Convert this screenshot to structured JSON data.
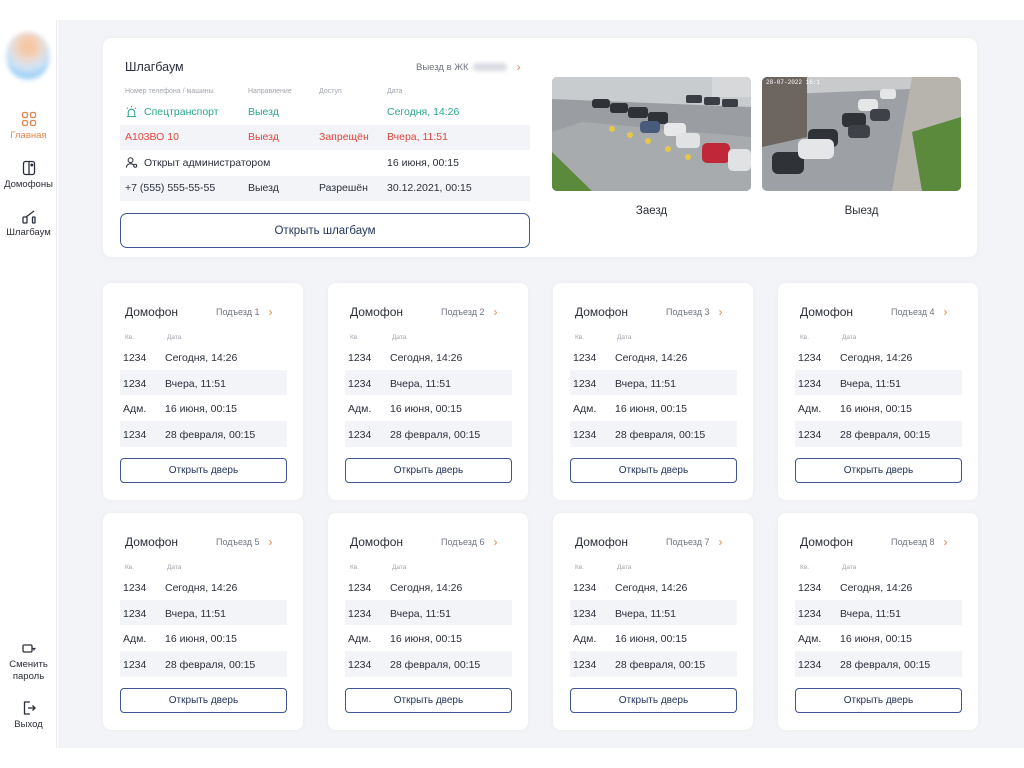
{
  "sidebar": {
    "items": [
      {
        "label": "Главная",
        "icon": "grid-icon",
        "active": true
      },
      {
        "label": "Домофоны",
        "icon": "intercom-icon"
      },
      {
        "label": "Шлагбаум",
        "icon": "barrier-icon"
      }
    ],
    "bottom": [
      {
        "label": "Сменить пароль",
        "icon": "key-icon"
      },
      {
        "label": "Выход",
        "icon": "logout-icon"
      }
    ]
  },
  "barrier": {
    "title": "Шлагбаум",
    "link_label": "Выезд в ЖК",
    "columns": [
      "Номер телефона / машины",
      "Направление",
      "Доступ",
      "Дата"
    ],
    "rows": [
      {
        "who": "Спецтранспорт",
        "dir": "Выезд",
        "access": "",
        "date": "Сегодня, 14:26",
        "style": "green",
        "icon": "siren-icon"
      },
      {
        "who": "А103ВО 10",
        "dir": "Выезд",
        "access": "Запрещён",
        "date": "Вчера, 11:51",
        "style": "red",
        "icon": ""
      },
      {
        "who": "Открыт администратором",
        "dir": "",
        "access": "",
        "date": "16 июня, 00:15",
        "style": "normal",
        "icon": "admin-icon"
      },
      {
        "who": "+7 (555) 555-55-55",
        "dir": "Выезд",
        "access": "Разрешён",
        "date": "30.12.2021, 00:15",
        "style": "normal",
        "icon": ""
      }
    ],
    "open_button": "Открыть шлагбаум",
    "cameras": [
      {
        "label": "Заезд",
        "timestamp": ""
      },
      {
        "label": "Выезд",
        "timestamp": "28-07-2022 16:1"
      }
    ]
  },
  "intercom": {
    "title": "Домофон",
    "col_apt": "Кв.",
    "col_date": "Дата",
    "button": "Открыть дверь",
    "cards": [
      {
        "entrance": "Подъезд 1"
      },
      {
        "entrance": "Подъезд 2"
      },
      {
        "entrance": "Подъезд 3"
      },
      {
        "entrance": "Подъезд 4"
      },
      {
        "entrance": "Подъезд 5"
      },
      {
        "entrance": "Подъезд 6"
      },
      {
        "entrance": "Подъезд 7"
      },
      {
        "entrance": "Подъезд 8"
      }
    ],
    "rows": [
      {
        "apt": "1234",
        "date": "Сегодня, 14:26"
      },
      {
        "apt": "1234",
        "date": "Вчера, 11:51"
      },
      {
        "apt": "Адм.",
        "date": "16 июня, 00:15"
      },
      {
        "apt": "1234",
        "date": "28 февраля, 00:15"
      }
    ]
  },
  "colors": {
    "accent": "#e6884e",
    "primary": "#3d5591",
    "green": "#2aa58d",
    "red": "#e2453c"
  }
}
